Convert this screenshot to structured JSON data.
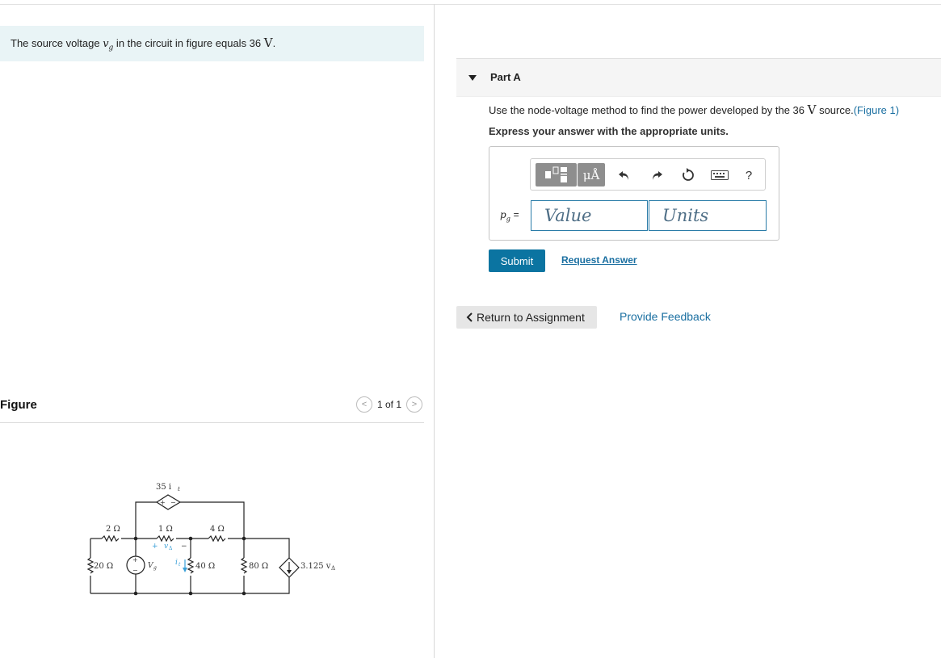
{
  "intro": {
    "text_before": "The source voltage ",
    "symbol": "v",
    "subscript": "g",
    "text_middle": " in the circuit in figure equals 36 ",
    "unit": "V",
    "text_after": "."
  },
  "figure": {
    "title": "Figure",
    "pager": "1 of 1",
    "prev_icon": "<",
    "next_icon": ">"
  },
  "circuit": {
    "labels": {
      "r1": "2 Ω",
      "r2": "1 Ω",
      "r3": "4 Ω",
      "r4": "20 Ω",
      "r5": "40 Ω",
      "r6": "80 Ω",
      "dep_v": "35 i",
      "dep_v_sub": "t",
      "dep_i": "3.125 v",
      "dep_i_sub": "Δ",
      "vg": "V",
      "vg_sub": "g",
      "it": "i",
      "it_sub": "t",
      "vd": "v",
      "vd_sub": "Δ",
      "plus": "+",
      "minus": "−"
    }
  },
  "part": {
    "title": "Part A",
    "question_before": "Use the node-voltage method to find the power developed by the 36 ",
    "question_unit": "V",
    "question_after": " source.",
    "figure_link": "(Figure 1)",
    "instruction": "Express your answer with the appropriate units."
  },
  "answer": {
    "variable": "p",
    "variable_sub": "g",
    "equals": "=",
    "value_placeholder": "Value",
    "units_placeholder": "Units",
    "mu_label": "μÅ",
    "help_label": "?"
  },
  "actions": {
    "submit": "Submit",
    "request_answer": "Request Answer",
    "return_label": "Return to Assignment",
    "feedback": "Provide Feedback"
  },
  "colors": {
    "accent": "#0b74a1",
    "link": "#1a6fa1",
    "intro_bg": "#e9f4f6",
    "current_arrow": "#3aa0d8"
  }
}
